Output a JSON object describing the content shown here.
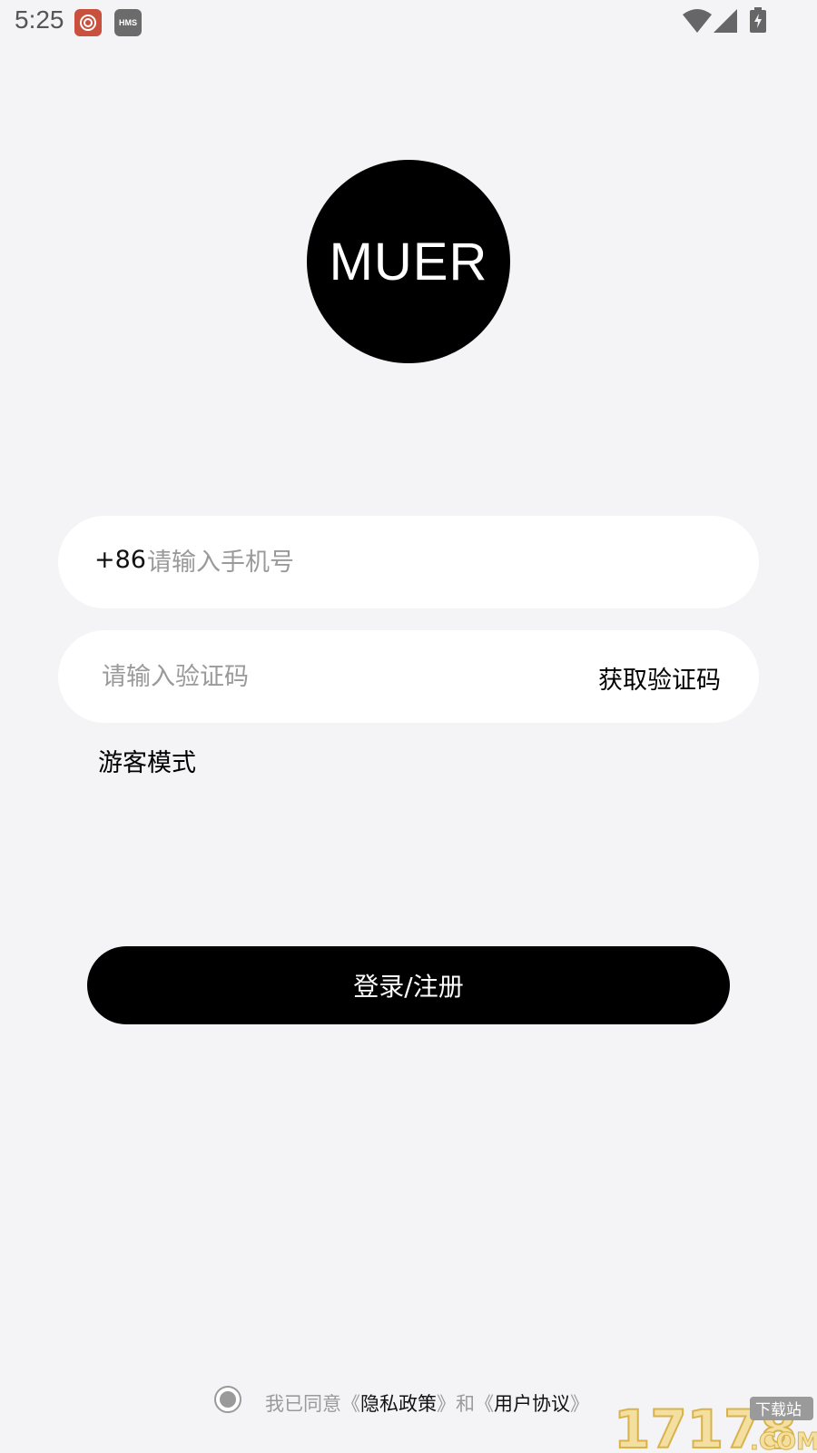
{
  "status_bar": {
    "time": "5:25",
    "hms_label": "HMS",
    "icons": [
      "app-notification-icon",
      "hms-icon",
      "wifi-icon",
      "signal-icon",
      "battery-charging-icon"
    ]
  },
  "logo": {
    "text": "MUER"
  },
  "phone": {
    "country_code": "+86",
    "placeholder": "请输入手机号",
    "value": ""
  },
  "code": {
    "placeholder": "请输入验证码",
    "value": "",
    "get_code_label": "获取验证码"
  },
  "guest_mode_label": "游客模式",
  "login_button_label": "登录/注册",
  "agreement": {
    "prefix": "我已同意《",
    "privacy_link": "隐私政策",
    "middle": "》和《",
    "terms_link": "用户协议",
    "suffix": "》"
  },
  "watermark": {
    "number": "17178",
    "tag": "下载站",
    "domain": ".COM"
  },
  "colors": {
    "background": "#f4f4f6",
    "primary": "#000000",
    "placeholder": "#9a9a9a",
    "watermark": "#e9c86a"
  }
}
